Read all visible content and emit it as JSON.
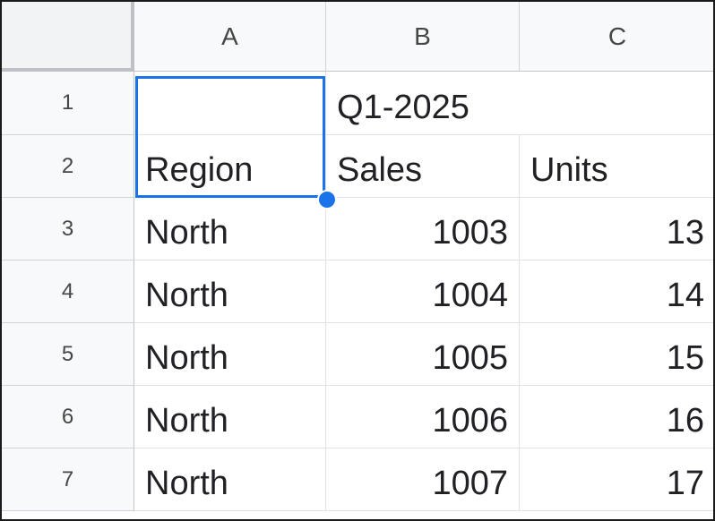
{
  "columns": [
    "A",
    "B",
    "C"
  ],
  "rows": [
    "1",
    "2",
    "3",
    "4",
    "5",
    "6",
    "7"
  ],
  "cells": {
    "B1": "Q1-2025",
    "A2": "Region",
    "B2": "Sales",
    "C2": "Units",
    "A3": "North",
    "B3": "1003",
    "C3": "13",
    "A4": "North",
    "B4": "1004",
    "C4": "14",
    "A5": "North",
    "B5": "1005",
    "C5": "15",
    "A6": "North",
    "B6": "1006",
    "C6": "16",
    "A7": "North",
    "B7": "1007",
    "C7": "17"
  },
  "selection": {
    "range": "A1:A2"
  },
  "colors": {
    "selection": "#1a73e8",
    "header_bg": "#f8f9fa",
    "grid": "#e1e3e1",
    "text": "#202124"
  }
}
